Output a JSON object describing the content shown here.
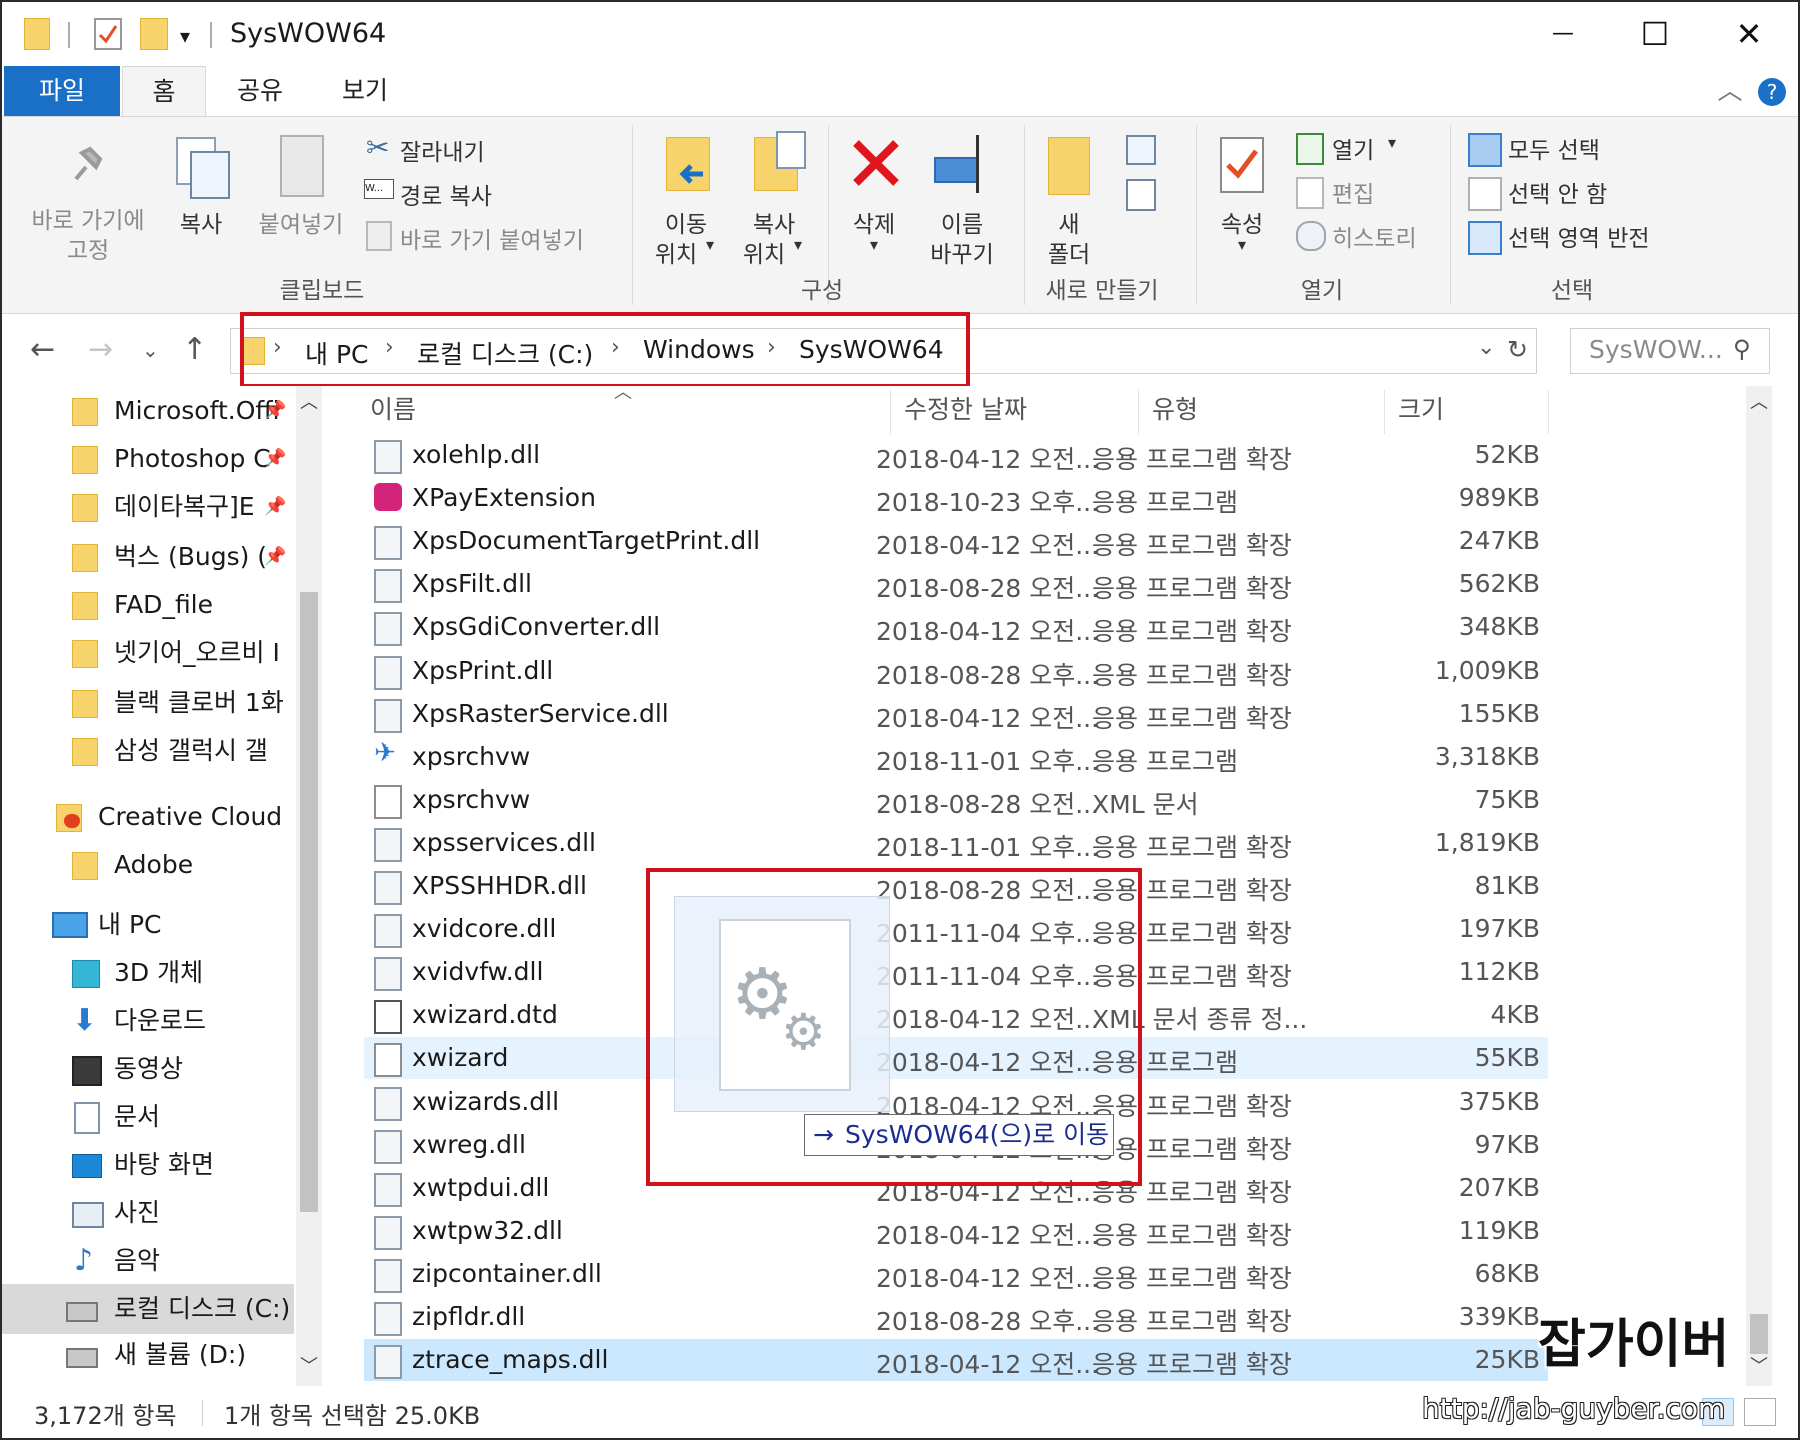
{
  "window": {
    "title": "SysWOW64",
    "minimize": "—",
    "maximize": "☐",
    "close": "✕"
  },
  "ribbon_tabs": [
    {
      "label": "파일"
    },
    {
      "label": "홈"
    },
    {
      "label": "공유"
    },
    {
      "label": "보기"
    }
  ],
  "ribbon": {
    "clipboard": {
      "pin_line1": "바로 가기에",
      "pin_line2": "고정",
      "copy": "복사",
      "paste": "붙여넣기",
      "cut": "잘라내기",
      "copy_path": "경로 복사",
      "paste_shortcut": "바로 가기 붙여넣기",
      "group": "클립보드"
    },
    "organize": {
      "move_line1": "이동",
      "move_line2": "위치",
      "copy_line1": "복사",
      "copy_line2": "위치",
      "delete": "삭제",
      "rename_line1": "이름",
      "rename_line2": "바꾸기",
      "group": "구성"
    },
    "new": {
      "folder_line1": "새",
      "folder_line2": "폴더",
      "group": "새로 만들기"
    },
    "open": {
      "properties": "속성",
      "open": "열기",
      "edit": "편집",
      "history": "히스토리",
      "group": "열기"
    },
    "select": {
      "select_all": "모두 선택",
      "select_none": "선택 안 함",
      "invert": "선택 영역 반전",
      "group": "선택"
    }
  },
  "address": {
    "crumbs": [
      "내 PC",
      "로컬 디스크 (C:)",
      "Windows",
      "SysWOW64"
    ],
    "search_placeholder": "SysWOW..."
  },
  "nav_pane": {
    "items": [
      {
        "label": "Microsoft.Offi"
      },
      {
        "label": "Photoshop C"
      },
      {
        "label": "데이타복구]E"
      },
      {
        "label": "벅스 (Bugs) ("
      },
      {
        "label": "FAD_file"
      },
      {
        "label": "넷기어_오르비 I"
      },
      {
        "label": "블랙 클로버 1화"
      },
      {
        "label": "삼성 갤럭시 갤"
      },
      {
        "label": "Creative Cloud Fil"
      },
      {
        "label": "Adobe"
      },
      {
        "label": "내 PC"
      },
      {
        "label": "3D 개체"
      },
      {
        "label": "다운로드"
      },
      {
        "label": "동영상"
      },
      {
        "label": "문서"
      },
      {
        "label": "바탕 화면"
      },
      {
        "label": "사진"
      },
      {
        "label": "음악"
      },
      {
        "label": "로컬 디스크 (C:)"
      },
      {
        "label": "새 볼륨 (D:)"
      }
    ]
  },
  "columns": {
    "name": "이름",
    "date": "수정한 날짜",
    "type": "유형",
    "size": "크기"
  },
  "files": [
    {
      "name": "xolehlp.dll",
      "date": "2018-04-12 오전...",
      "type": "응용 프로그램 확장",
      "size": "52KB"
    },
    {
      "name": "XPayExtension",
      "date": "2018-10-23 오후...",
      "type": "응용 프로그램",
      "size": "989KB"
    },
    {
      "name": "XpsDocumentTargetPrint.dll",
      "date": "2018-04-12 오전...",
      "type": "응용 프로그램 확장",
      "size": "247KB"
    },
    {
      "name": "XpsFilt.dll",
      "date": "2018-08-28 오전...",
      "type": "응용 프로그램 확장",
      "size": "562KB"
    },
    {
      "name": "XpsGdiConverter.dll",
      "date": "2018-04-12 오전...",
      "type": "응용 프로그램 확장",
      "size": "348KB"
    },
    {
      "name": "XpsPrint.dll",
      "date": "2018-08-28 오후...",
      "type": "응용 프로그램 확장",
      "size": "1,009KB"
    },
    {
      "name": "XpsRasterService.dll",
      "date": "2018-04-12 오전...",
      "type": "응용 프로그램 확장",
      "size": "155KB"
    },
    {
      "name": "xpsrchvw",
      "date": "2018-11-01 오후...",
      "type": "응용 프로그램",
      "size": "3,318KB"
    },
    {
      "name": "xpsrchvw",
      "date": "2018-08-28 오전...",
      "type": "XML 문서",
      "size": "75KB"
    },
    {
      "name": "xpsservices.dll",
      "date": "2018-11-01 오후...",
      "type": "응용 프로그램 확장",
      "size": "1,819KB"
    },
    {
      "name": "XPSSHHDR.dll",
      "date": "2018-08-28 오전...",
      "type": "응용 프로그램 확장",
      "size": "81KB"
    },
    {
      "name": "xvidcore.dll",
      "date": "2011-11-04 오후...",
      "type": "응용 프로그램 확장",
      "size": "197KB"
    },
    {
      "name": "xvidvfw.dll",
      "date": "2011-11-04 오후...",
      "type": "응용 프로그램 확장",
      "size": "112KB"
    },
    {
      "name": "xwizard.dtd",
      "date": "2018-04-12 오전...",
      "type": "XML 문서 종류 정...",
      "size": "4KB"
    },
    {
      "name": "xwizard",
      "date": "2018-04-12 오전...",
      "type": "응용 프로그램",
      "size": "55KB"
    },
    {
      "name": "xwizards.dll",
      "date": "2018-04-12 오전...",
      "type": "응용 프로그램 확장",
      "size": "375KB"
    },
    {
      "name": "xwreg.dll",
      "date": "2018-04-12 오전...",
      "type": "응용 프로그램 확장",
      "size": "97KB"
    },
    {
      "name": "xwtpdui.dll",
      "date": "2018-04-12 오전...",
      "type": "응용 프로그램 확장",
      "size": "207KB"
    },
    {
      "name": "xwtpw32.dll",
      "date": "2018-04-12 오전...",
      "type": "응용 프로그램 확장",
      "size": "119KB"
    },
    {
      "name": "zipcontainer.dll",
      "date": "2018-04-12 오전...",
      "type": "응용 프로그램 확장",
      "size": "68KB"
    },
    {
      "name": "zipfldr.dll",
      "date": "2018-08-28 오후...",
      "type": "응용 프로그램 확장",
      "size": "339KB"
    },
    {
      "name": "ztrace_maps.dll",
      "date": "2018-04-12 오전...",
      "type": "응용 프로그램 확장",
      "size": "25KB"
    }
  ],
  "drag": {
    "tooltip": "SysWOW64(으)로 이동"
  },
  "status": {
    "count": "3,172개 항목",
    "selected": "1개 항목 선택함 25.0KB"
  },
  "watermark": {
    "title": "잡가이버",
    "url": "http://jab-guyber.com"
  },
  "colors": {
    "accent": "#1a6fc6",
    "highlight_box": "#d0121d",
    "selection": "#cce8ff",
    "hover": "#e5f3ff"
  }
}
